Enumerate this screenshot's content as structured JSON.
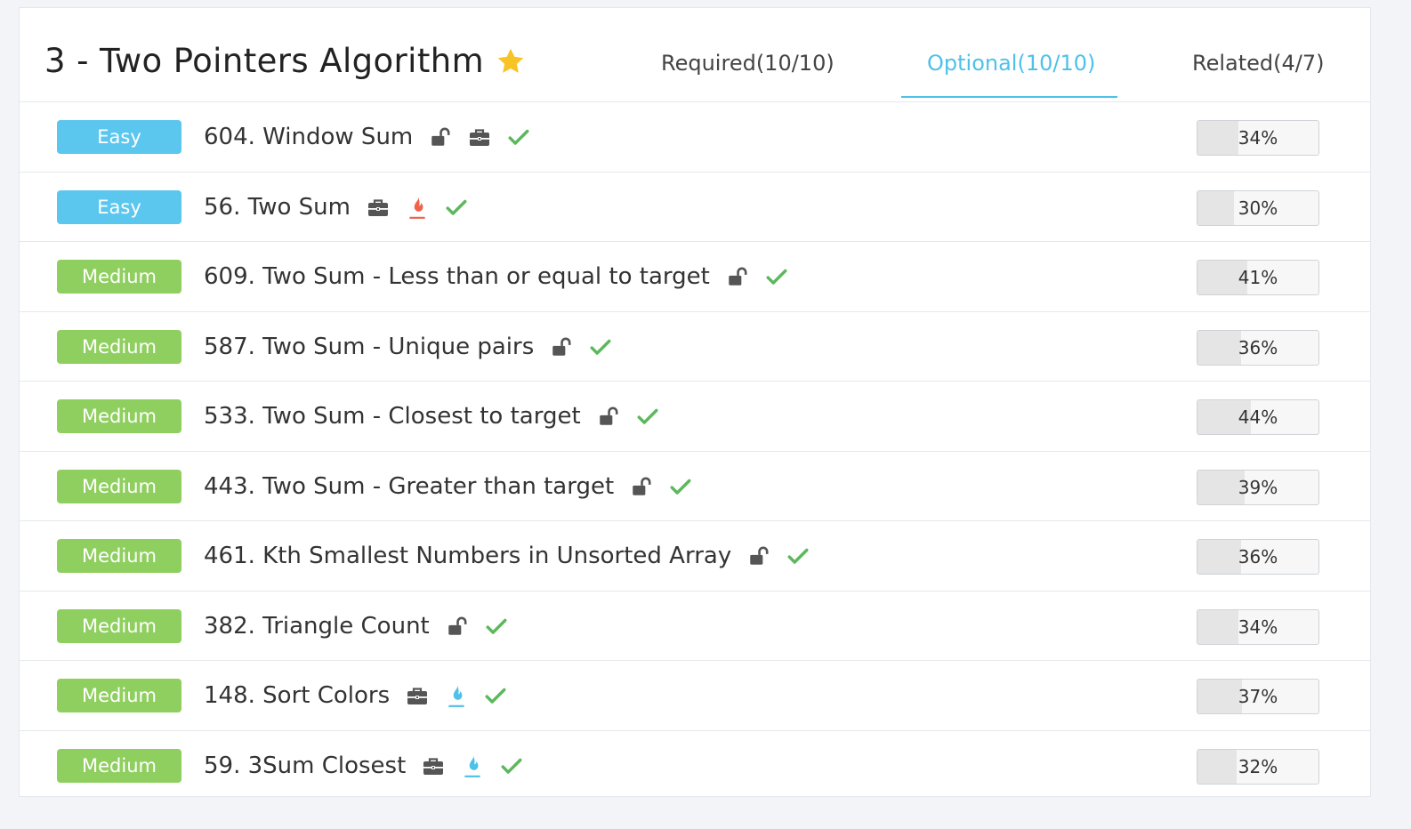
{
  "header": {
    "title": "3 - Two Pointers Algorithm",
    "tabs": [
      {
        "label": "Required(10/10)",
        "active": false
      },
      {
        "label": "Optional(10/10)",
        "active": true
      },
      {
        "label": "Related(4/7)",
        "active": false
      }
    ]
  },
  "colors": {
    "accent": "#4ec1e8",
    "easy": "#5bc7ef",
    "medium": "#8fcf5f",
    "check": "#5cb85c",
    "hot_red": "#f0624a",
    "hot_blue": "#4ec1e8",
    "icon_gray": "#555555"
  },
  "problems": [
    {
      "difficulty": "Easy",
      "title": "604. Window Sum",
      "icons": [
        "lock-open-icon",
        "briefcase-icon",
        "check-icon"
      ],
      "progress_label": "34%",
      "progress": 34
    },
    {
      "difficulty": "Easy",
      "title": "56. Two Sum",
      "icons": [
        "briefcase-icon",
        "flame-red-icon",
        "check-icon"
      ],
      "progress_label": "30%",
      "progress": 30
    },
    {
      "difficulty": "Medium",
      "title": "609. Two Sum - Less than or equal to target",
      "icons": [
        "lock-open-icon",
        "check-icon"
      ],
      "progress_label": "41%",
      "progress": 41
    },
    {
      "difficulty": "Medium",
      "title": "587. Two Sum - Unique pairs",
      "icons": [
        "lock-open-icon",
        "check-icon"
      ],
      "progress_label": "36%",
      "progress": 36
    },
    {
      "difficulty": "Medium",
      "title": "533. Two Sum - Closest to target",
      "icons": [
        "lock-open-icon",
        "check-icon"
      ],
      "progress_label": "44%",
      "progress": 44
    },
    {
      "difficulty": "Medium",
      "title": "443. Two Sum - Greater than target",
      "icons": [
        "lock-open-icon",
        "check-icon"
      ],
      "progress_label": "39%",
      "progress": 39
    },
    {
      "difficulty": "Medium",
      "title": "461. Kth Smallest Numbers in Unsorted Array",
      "icons": [
        "lock-open-icon",
        "check-icon"
      ],
      "progress_label": "36%",
      "progress": 36
    },
    {
      "difficulty": "Medium",
      "title": "382. Triangle Count",
      "icons": [
        "lock-open-icon",
        "check-icon"
      ],
      "progress_label": "34%",
      "progress": 34
    },
    {
      "difficulty": "Medium",
      "title": "148. Sort Colors",
      "icons": [
        "briefcase-icon",
        "flame-blue-icon",
        "check-icon"
      ],
      "progress_label": "37%",
      "progress": 37
    },
    {
      "difficulty": "Medium",
      "title": "59. 3Sum Closest",
      "icons": [
        "briefcase-icon",
        "flame-blue-icon",
        "check-icon"
      ],
      "progress_label": "32%",
      "progress": 32
    }
  ]
}
